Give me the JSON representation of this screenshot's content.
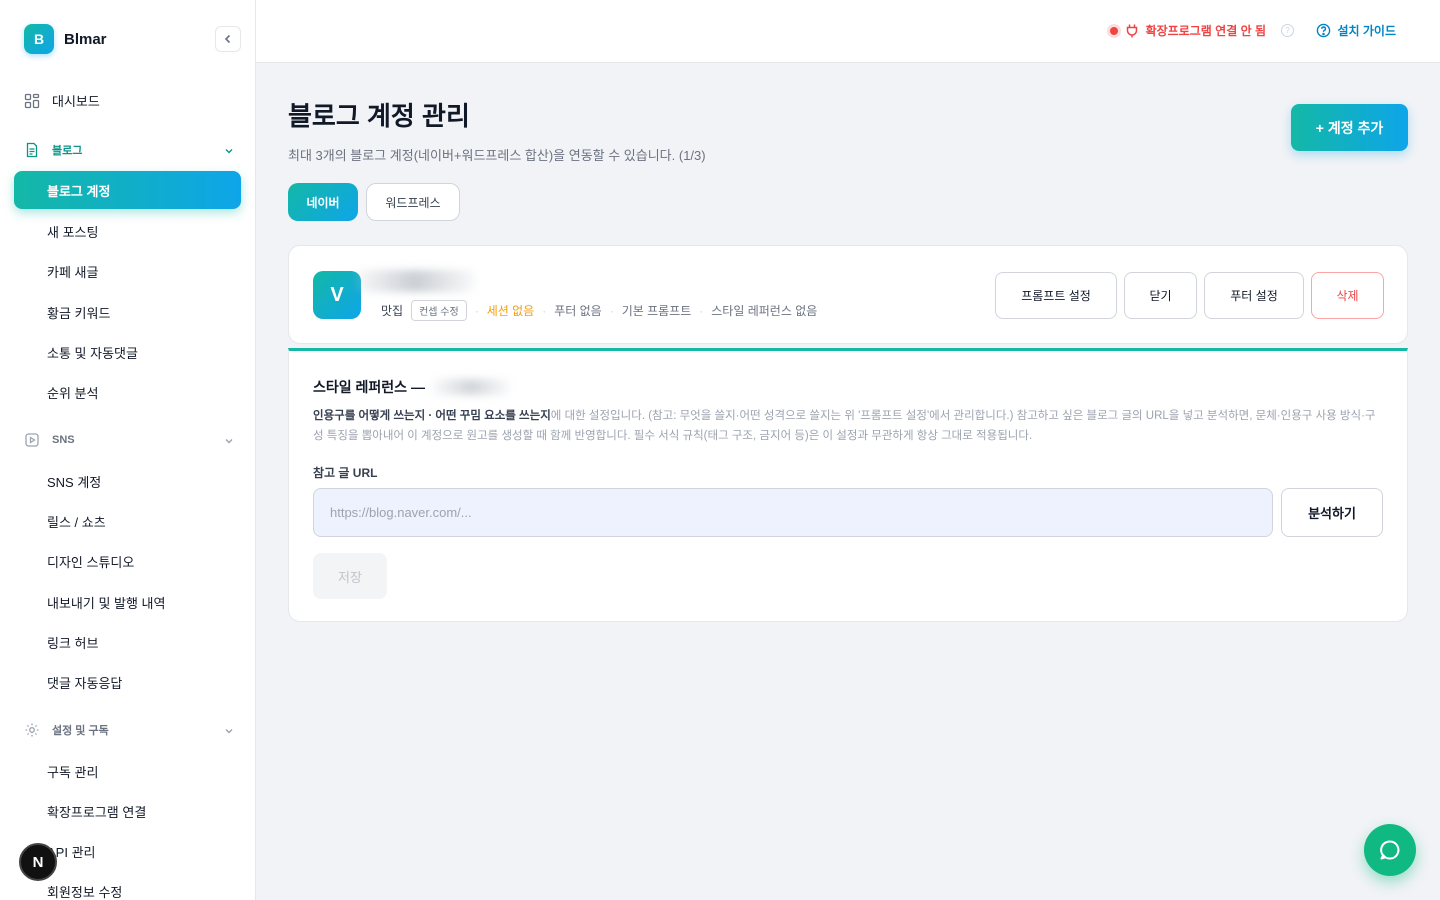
{
  "app": {
    "logo_letter": "B",
    "name": "Blmar"
  },
  "sidebar": {
    "dashboard": "대시보드",
    "sections": [
      {
        "label": "블로그",
        "icon": "document-icon"
      },
      {
        "label": "SNS",
        "icon": "play-icon"
      },
      {
        "label": "설정 및 구독",
        "icon": "gear-icon"
      }
    ],
    "blog_items": [
      "블로그 계정",
      "새 포스팅",
      "카페 새글",
      "황금 키워드",
      "소통 및 자동댓글",
      "순위 분석"
    ],
    "sns_items": [
      "SNS 계정",
      "릴스 / 쇼츠",
      "디자인 스튜디오",
      "내보내기 및 발행 내역",
      "링크 허브",
      "댓글 자동응답"
    ],
    "settings_items": [
      "구독 관리",
      "확장프로그램 연결",
      "API 관리",
      "회원정보 수정"
    ],
    "floating_badge": "N"
  },
  "topbar": {
    "extension_status": "확장프로그램 연결 안 됨",
    "help_mark": "?",
    "install_guide": "설치 가이드",
    "status_color": "#ef4444"
  },
  "main": {
    "title": "블로그 계정 관리",
    "subtitle": "최대 3개의 블로그 계정(네이버+워드프레스 합산)을 연동할 수 있습니다. (1/3)",
    "add_button": "+ 계정 추가",
    "tabs": [
      {
        "label": "네이버",
        "active": true
      },
      {
        "label": "워드프레스",
        "active": false
      }
    ]
  },
  "account": {
    "avatar_letter": "V",
    "category": "맛집",
    "concept_badge": "컨셉 수정",
    "session": "세션 없음",
    "footer": "푸터 없음",
    "prompt": "기본 프롬프트",
    "style_ref": "스타일 레퍼런스 없음",
    "buttons": {
      "prompt": "프롬프트 설정",
      "close": "닫기",
      "footer": "푸터 설정",
      "delete": "삭제"
    }
  },
  "style_reference": {
    "title": "스타일 레퍼런스 —",
    "desc_bold": "인용구를 어떻게 쓰는지 · 어떤 꾸밈 요소를 쓰는지",
    "desc_rest": "에 대한 설정입니다. (참고: 무엇을 쓸지·어떤 성격으로 쓸지는 위 '프롬프트 설정'에서 관리합니다.) 참고하고 싶은 블로그 글의 URL을 넣고 분석하면, 문체·인용구 사용 방식·구성 특징을 뽑아내어 이 계정으로 원고를 생성할 때 함께 반영합니다. 필수 서식 규칙(태그 구조, 금지어 등)은 이 설정과 무관하게 항상 그대로 적용됩니다.",
    "url_label": "참고 글 URL",
    "url_placeholder": "https://blog.naver.com/...",
    "url_value": "",
    "analyze_button": "분석하기",
    "save_button": "저장"
  },
  "colors": {
    "accent_start": "#14b8a6",
    "accent_end": "#0ea5e9",
    "chat_fab": "#10b981"
  }
}
